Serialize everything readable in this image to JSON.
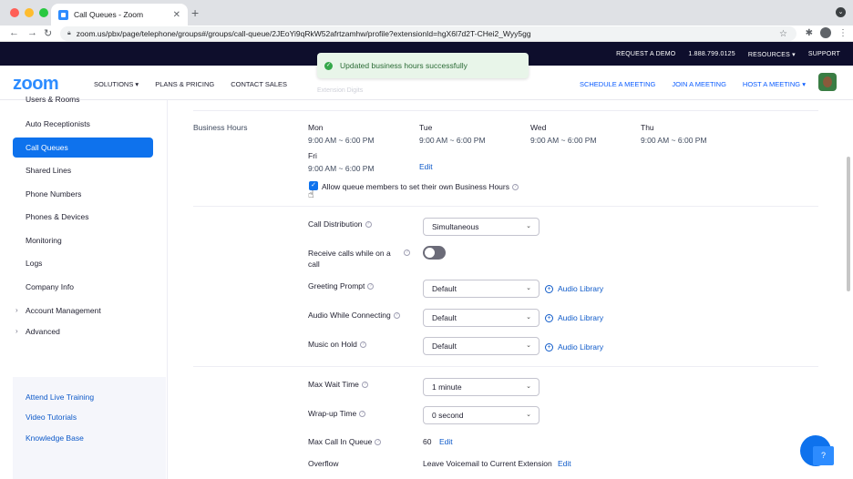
{
  "browser": {
    "tab_title": "Call Queues - Zoom",
    "url": "zoom.us/pbx/page/telephone/groups#/groups/call-queue/2JEoYi9qRkW52afrtzamhw/profile?extensionId=hgX6l7d2T-CHei2_Wyy5gg",
    "new_tab_label": "+"
  },
  "top_strip": {
    "links": [
      "REQUEST A DEMO",
      "1.888.799.0125",
      "RESOURCES",
      "SUPPORT"
    ]
  },
  "nav": {
    "logo": "zoom",
    "left_links": [
      "SOLUTIONS",
      "PLANS & PRICING",
      "CONTACT SALES"
    ],
    "right_links": [
      "SCHEDULE A MEETING",
      "JOIN A MEETING",
      "HOST A MEETING"
    ]
  },
  "toast": {
    "message": "Updated business hours successfully"
  },
  "faded_text": "Extension Digits",
  "sidebar": {
    "items": [
      "Users & Rooms",
      "Auto Receptionists",
      "Call Queues",
      "Shared Lines",
      "Phone Numbers",
      "Phones & Devices",
      "Monitoring",
      "Logs",
      "Company Info",
      "Account Management",
      "Advanced"
    ],
    "help_links": [
      "Attend Live Training",
      "Video Tutorials",
      "Knowledge Base"
    ]
  },
  "business_hours": {
    "label": "Business Hours",
    "days": [
      {
        "day": "Mon",
        "hours": "9:00 AM ~ 6:00 PM"
      },
      {
        "day": "Tue",
        "hours": "9:00 AM ~ 6:00 PM"
      },
      {
        "day": "Wed",
        "hours": "9:00 AM ~ 6:00 PM"
      },
      {
        "day": "Thu",
        "hours": "9:00 AM ~ 6:00 PM"
      },
      {
        "day": "Fri",
        "hours": "9:00 AM ~ 6:00 PM"
      }
    ],
    "edit_label": "Edit",
    "allow_members_label": "Allow queue members to set their own Business Hours",
    "allow_members_checked": true
  },
  "settings": {
    "call_distribution": {
      "label": "Call Distribution",
      "value": "Simultaneous"
    },
    "receive_calls": {
      "label_line1": "Receive calls while on a",
      "label_line2": "call",
      "enabled": false
    },
    "greeting_prompt": {
      "label": "Greeting Prompt",
      "value": "Default"
    },
    "audio_while_connecting": {
      "label": "Audio While Connecting",
      "value": "Default"
    },
    "music_on_hold": {
      "label": "Music on Hold",
      "value": "Default"
    },
    "audio_library_label": "Audio Library",
    "max_wait_time": {
      "label": "Max Wait Time",
      "value": "1 minute"
    },
    "wrap_up_time": {
      "label": "Wrap-up Time",
      "value": "0 second"
    },
    "max_call_in_queue": {
      "label": "Max Call In Queue",
      "value": "60",
      "edit": "Edit"
    },
    "overflow": {
      "label": "Overflow",
      "value": "Leave Voicemail to Current Extension",
      "edit": "Edit"
    }
  },
  "help_button": "?",
  "colors": {
    "brand": "#2D8CFF",
    "active_nav": "#0e72ed",
    "dark_strip": "#0e0e2c",
    "toast_bg": "#e8f5e9"
  }
}
